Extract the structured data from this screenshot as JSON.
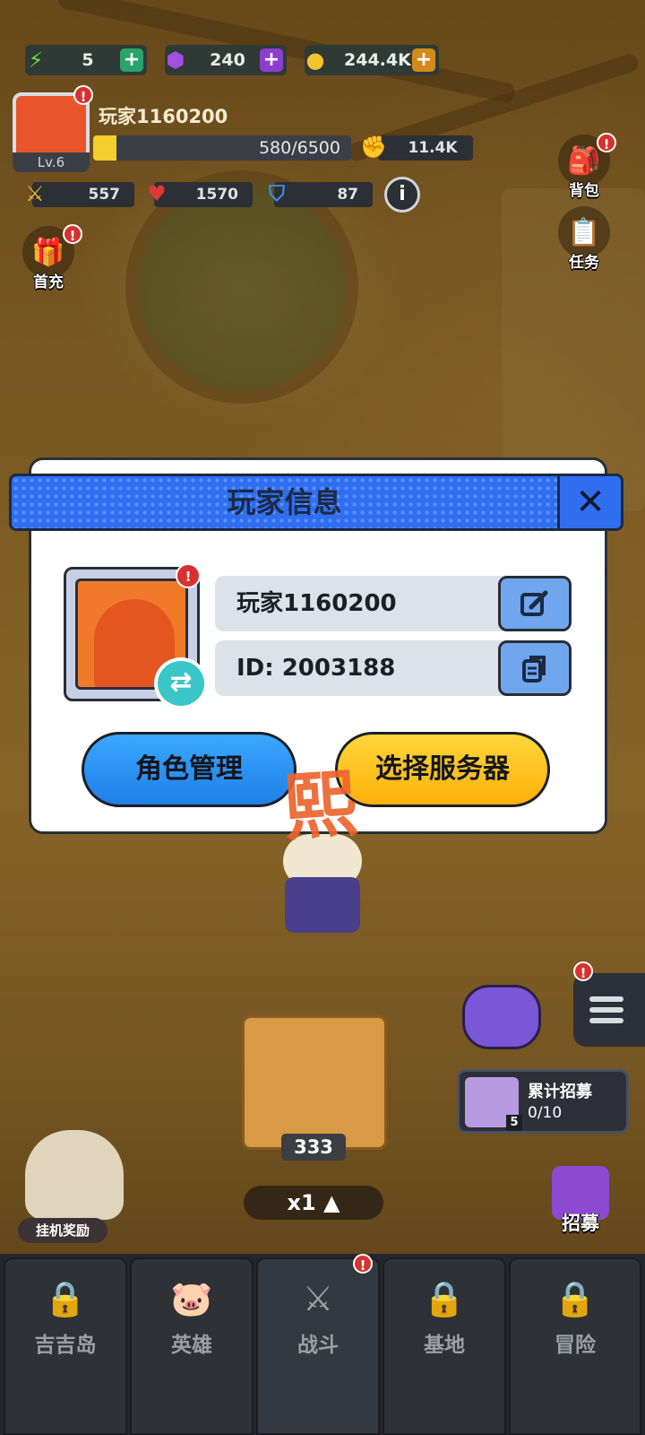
{
  "resources": {
    "energy": {
      "value": "5",
      "icon": "lightning-icon"
    },
    "gems": {
      "value": "240",
      "icon": "gem-icon"
    },
    "coins": {
      "value": "244.4K",
      "icon": "coin-icon"
    }
  },
  "player": {
    "name": "玩家1160200",
    "level": "Lv.6",
    "exp_text": "580/6500",
    "exp_progress": 0.089,
    "power": "11.4K"
  },
  "stats": {
    "attack": "557",
    "health": "1570",
    "defense": "87"
  },
  "side_buttons": {
    "backpack": "背包",
    "tasks": "任务",
    "first_recharge": "首充"
  },
  "modal": {
    "title": "玩家信息",
    "close_symbol": "✕",
    "player_name": "玩家1160200",
    "player_id": "ID: 2003188",
    "role_button": "角色管理",
    "server_button": "选择服务器",
    "stamp_text": "熙"
  },
  "lower": {
    "chest_count": "333",
    "speed": "x1 ▲",
    "idle_reward": "挂机奖励",
    "recruit_card_title": "累计招募",
    "recruit_card_progress": "0/10",
    "recruit_card_badge": "5",
    "recruit_button": "招募"
  },
  "nav": {
    "items": [
      {
        "label": "吉吉岛",
        "icon": "lock-icon"
      },
      {
        "label": "英雄",
        "icon": "hero-icon"
      },
      {
        "label": "战斗",
        "icon": "battle-icon"
      },
      {
        "label": "基地",
        "icon": "lock-icon"
      },
      {
        "label": "冒险",
        "icon": "lock-icon"
      }
    ]
  },
  "colors": {
    "modal_header": "#2f6ef0",
    "primary_button": "#2a8ff0",
    "secondary_button": "#ffc21a",
    "alert": "#d7322f"
  }
}
